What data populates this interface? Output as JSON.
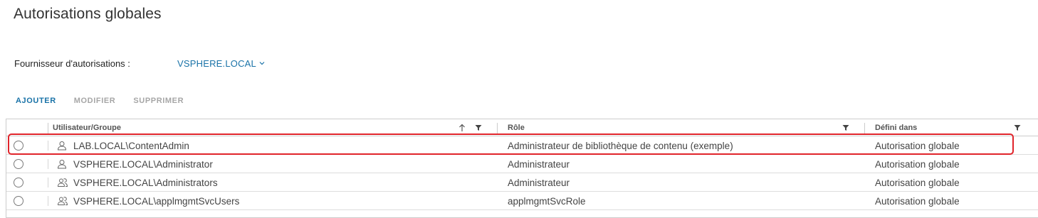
{
  "page": {
    "title": "Autorisations globales"
  },
  "provider": {
    "label": "Fournisseur d'autorisations :",
    "value": "VSPHERE.LOCAL"
  },
  "toolbar": {
    "add": "AJOUTER",
    "edit": "MODIFIER",
    "delete": "SUPPRIMER"
  },
  "grid": {
    "columns": {
      "user": "Utilisateur/Groupe",
      "role": "Rôle",
      "defined_in": "Défini dans"
    },
    "rows": [
      {
        "user": "LAB.LOCAL\\ContentAdmin",
        "type": "user-icon",
        "role": "Administrateur de bibliothèque de contenu (exemple)",
        "defined_in": "Autorisation globale"
      },
      {
        "user": "VSPHERE.LOCAL\\Administrator",
        "type": "user-icon",
        "role": "Administrateur",
        "defined_in": "Autorisation globale"
      },
      {
        "user": "VSPHERE.LOCAL\\Administrators",
        "type": "group-icon",
        "role": "Administrateur",
        "defined_in": "Autorisation globale"
      },
      {
        "user": "VSPHERE.LOCAL\\applmgmtSvcUsers",
        "type": "group-icon",
        "role": "applmgmtSvcRole",
        "defined_in": "Autorisation globale"
      }
    ]
  },
  "colors": {
    "accent": "#1a73a8",
    "highlight": "#e0242b",
    "disabled": "#a6a6a6"
  }
}
